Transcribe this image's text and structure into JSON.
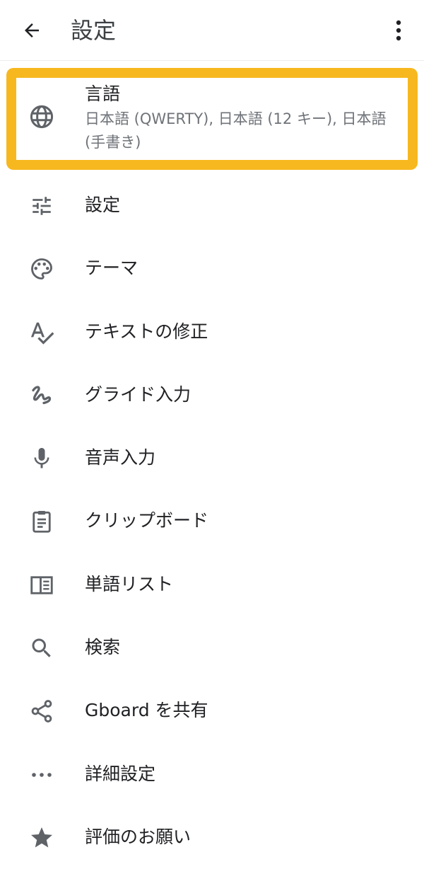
{
  "header": {
    "title": "設定",
    "back_icon": "arrow-back-icon",
    "overflow_icon": "more-vert-icon"
  },
  "highlight": {
    "title": "言語",
    "summary": "日本語 (QWERTY), 日本語 (12 キー), 日本語 (手書き)",
    "icon": "globe-icon",
    "border_color": "#f7b81f"
  },
  "items": [
    {
      "label": "設定",
      "icon": "tune-icon"
    },
    {
      "label": "テーマ",
      "icon": "palette-icon"
    },
    {
      "label": "テキストの修正",
      "icon": "spellcheck-icon"
    },
    {
      "label": "グライド入力",
      "icon": "gesture-icon"
    },
    {
      "label": "音声入力",
      "icon": "mic-icon"
    },
    {
      "label": "クリップボード",
      "icon": "clipboard-icon"
    },
    {
      "label": "単語リスト",
      "icon": "dictionary-icon"
    },
    {
      "label": "検索",
      "icon": "search-icon"
    },
    {
      "label": "Gboard を共有",
      "icon": "share-icon"
    },
    {
      "label": "詳細設定",
      "icon": "more-horiz-icon"
    },
    {
      "label": "評価のお願い",
      "icon": "star-icon"
    }
  ],
  "colors": {
    "icon": "#5f6368",
    "text": "#202124",
    "secondary_text": "#6f7378",
    "accent_highlight": "#f7b81f"
  }
}
